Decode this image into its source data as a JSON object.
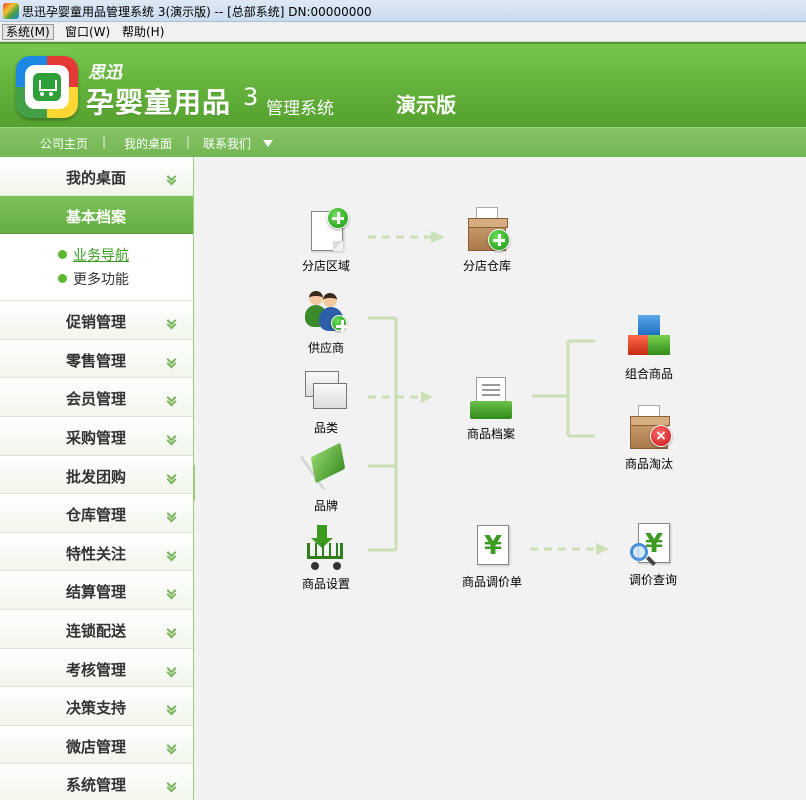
{
  "window": {
    "title": "思迅孕婴童用品管理系统 3(演示版) -- [总部系统] DN:00000000"
  },
  "menubar": {
    "items": [
      "系统(M)",
      "窗口(W)",
      "帮助(H)"
    ]
  },
  "header": {
    "brand_small": "思迅",
    "brand_big": "孕婴童用品",
    "brand_num": "3",
    "brand_sub": "管理系统",
    "edition": "演示版"
  },
  "navbar": {
    "links": [
      "公司主页",
      "我的桌面",
      "联系我们"
    ],
    "separator": "|"
  },
  "sidebar": {
    "items": [
      "我的桌面",
      "基本档案",
      "促销管理",
      "零售管理",
      "会员管理",
      "采购管理",
      "批发团购",
      "仓库管理",
      "特性关注",
      "结算管理",
      "连锁配送",
      "考核管理",
      "决策支持",
      "微店管理",
      "系统管理"
    ],
    "active_index": 1,
    "sub_items": [
      "业务导航",
      "更多功能"
    ]
  },
  "flow": {
    "nodes": {
      "branch_area": "分店区域",
      "branch_warehouse": "分店仓库",
      "supplier": "供应商",
      "category": "品类",
      "brand": "品牌",
      "product_settings": "商品设置",
      "product_archive": "商品档案",
      "combo_product": "组合商品",
      "product_retire": "商品淘汰",
      "price_adjust": "商品调价单",
      "price_query": "调价查询"
    },
    "yen_symbol": "¥",
    "remove_symbol": "×"
  },
  "colors": {
    "brand_green": "#66b43e",
    "nav_green": "#79bb58",
    "connector": "#c9dfb6",
    "link_green": "#3a9a1f"
  }
}
